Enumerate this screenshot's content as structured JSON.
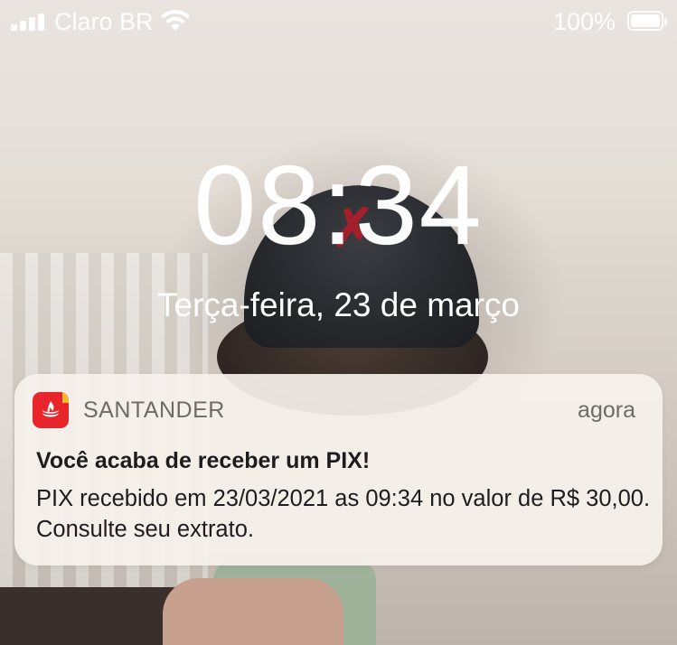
{
  "status_bar": {
    "carrier": "Claro BR",
    "battery_percent": "100%",
    "battery_level": 1.0,
    "signal_icon": "cellular-signal-icon",
    "wifi_icon": "wifi-icon",
    "battery_icon": "battery-icon"
  },
  "lock_screen": {
    "time": "08:34",
    "date": "Terça-feira, 23 de março"
  },
  "notification": {
    "app_name": "SANTANDER",
    "app_icon": "santander-flame-icon",
    "app_color": "#e8252b",
    "time_ago": "agora",
    "title": "Você acaba de receber um PIX!",
    "body": "PIX recebido em 23/03/2021 as 09:34 no valor de R$ 30,00. Consulte seu extrato."
  }
}
